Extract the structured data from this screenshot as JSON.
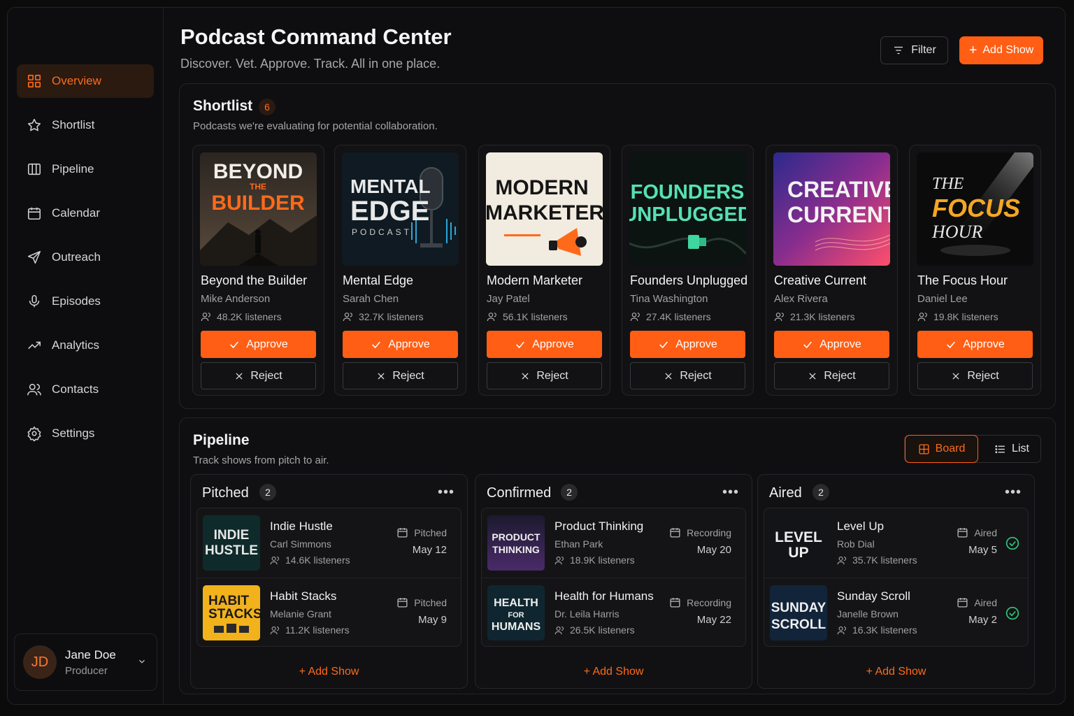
{
  "header": {
    "title": "Podcast Command Center",
    "subtitle": "Discover. Vet. Approve. Track. All in one place.",
    "filter_label": "Filter",
    "add_show_label": "Add Show"
  },
  "sidebar": {
    "items": [
      {
        "label": "Overview",
        "icon": "grid-icon"
      },
      {
        "label": "Shortlist",
        "icon": "star-icon"
      },
      {
        "label": "Pipeline",
        "icon": "columns-icon"
      },
      {
        "label": "Calendar",
        "icon": "calendar-icon"
      },
      {
        "label": "Outreach",
        "icon": "send-icon"
      },
      {
        "label": "Episodes",
        "icon": "microphone-icon"
      },
      {
        "label": "Analytics",
        "icon": "trend-icon"
      },
      {
        "label": "Contacts",
        "icon": "users-icon"
      },
      {
        "label": "Settings",
        "icon": "gear-icon"
      }
    ],
    "user": {
      "initials": "JD",
      "name": "Jane Doe",
      "role": "Producer"
    }
  },
  "shortlist": {
    "title": "Shortlist",
    "count": "6",
    "subtitle": "Podcasts we're evaluating for potential collaboration.",
    "approve_label": "Approve",
    "reject_label": "Reject",
    "shows": [
      {
        "name": "Beyond the Builder",
        "host": "Mike Anderson",
        "listeners": "48.2K listeners",
        "cover": [
          "BEYOND",
          "THE",
          "BUILDER"
        ]
      },
      {
        "name": "Mental Edge",
        "host": "Sarah Chen",
        "listeners": "32.7K listeners",
        "cover": [
          "MENTAL",
          "EDGE",
          "PODCAST"
        ]
      },
      {
        "name": "Modern Marketer",
        "host": "Jay Patel",
        "listeners": "56.1K listeners",
        "cover": [
          "MODERN",
          "MARKETER"
        ]
      },
      {
        "name": "Founders Unplugged",
        "host": "Tina Washington",
        "listeners": "27.4K listeners",
        "cover": [
          "FOUNDERS",
          "UNPLUGGED"
        ]
      },
      {
        "name": "Creative Current",
        "host": "Alex Rivera",
        "listeners": "21.3K listeners",
        "cover": [
          "CREATIVE",
          "CURRENT"
        ]
      },
      {
        "name": "The Focus Hour",
        "host": "Daniel Lee",
        "listeners": "19.8K listeners",
        "cover": [
          "THE",
          "FOCUS",
          "HOUR"
        ]
      }
    ]
  },
  "pipeline": {
    "title": "Pipeline",
    "subtitle": "Track shows from pitch to air.",
    "board_label": "Board",
    "list_label": "List",
    "add_show_label": "Add Show",
    "columns": [
      {
        "title": "Pitched",
        "count": "2",
        "items": [
          {
            "name": "Indie Hustle",
            "host": "Carl Simmons",
            "listeners": "14.6K listeners",
            "status": "Pitched",
            "date": "May 12",
            "cover": [
              "INDIE",
              "HUSTLE"
            ]
          },
          {
            "name": "Habit Stacks",
            "host": "Melanie Grant",
            "listeners": "11.2K listeners",
            "status": "Pitched",
            "date": "May 9",
            "cover": [
              "HABIT",
              "STACKS"
            ]
          }
        ]
      },
      {
        "title": "Confirmed",
        "count": "2",
        "items": [
          {
            "name": "Product Thinking",
            "host": "Ethan Park",
            "listeners": "18.9K listeners",
            "status": "Recording",
            "date": "May 20",
            "cover": [
              "PRODUCT",
              "THINKING"
            ]
          },
          {
            "name": "Health for Humans",
            "host": "Dr. Leila Harris",
            "listeners": "26.5K listeners",
            "status": "Recording",
            "date": "May 22",
            "cover": [
              "HEALTH",
              "FOR",
              "HUMANS"
            ]
          }
        ]
      },
      {
        "title": "Aired",
        "count": "2",
        "items": [
          {
            "name": "Level Up",
            "host": "Rob Dial",
            "listeners": "35.7K listeners",
            "status": "Aired",
            "date": "May 5",
            "cover": [
              "LEVEL",
              "UP"
            ]
          },
          {
            "name": "Sunday Scroll",
            "host": "Janelle Brown",
            "listeners": "16.3K listeners",
            "status": "Aired",
            "date": "May 2",
            "cover": [
              "SUNDAY",
              "SCROLL"
            ]
          }
        ]
      }
    ]
  },
  "colors": {
    "accent": "#ff5e14",
    "check": "#2fc47a"
  }
}
